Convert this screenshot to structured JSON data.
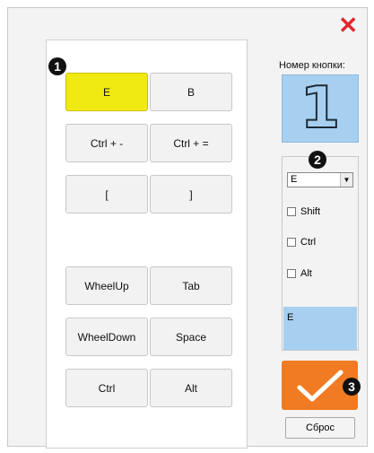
{
  "window": {
    "close_symbol": "✕"
  },
  "keys": [
    {
      "label": "E",
      "active": true
    },
    {
      "label": "B"
    },
    {
      "label": "Ctrl + -"
    },
    {
      "label": "Ctrl + ="
    },
    {
      "label": "["
    },
    {
      "label": "]"
    },
    {
      "label": "WheelUp"
    },
    {
      "label": "Tab"
    },
    {
      "label": "WheelDown"
    },
    {
      "label": "Space"
    },
    {
      "label": "Ctrl"
    },
    {
      "label": "Alt"
    }
  ],
  "badges": [
    "1",
    "2",
    "3"
  ],
  "side": {
    "button_number_label": "Номер кнопки:",
    "button_number": "1",
    "selected_key": "E",
    "modifiers": [
      "Shift",
      "Ctrl",
      "Alt"
    ],
    "preview_text": "E",
    "reset_label": "Сброс"
  },
  "colors": {
    "active_key": "#f0ea12",
    "accent_blue": "#a7d0f0",
    "ok_orange": "#f07b22",
    "close_red": "#e0262f"
  },
  "icons": {
    "close": "close-icon",
    "ok": "checkmark-icon",
    "dropdown": "chevron-down-icon"
  }
}
